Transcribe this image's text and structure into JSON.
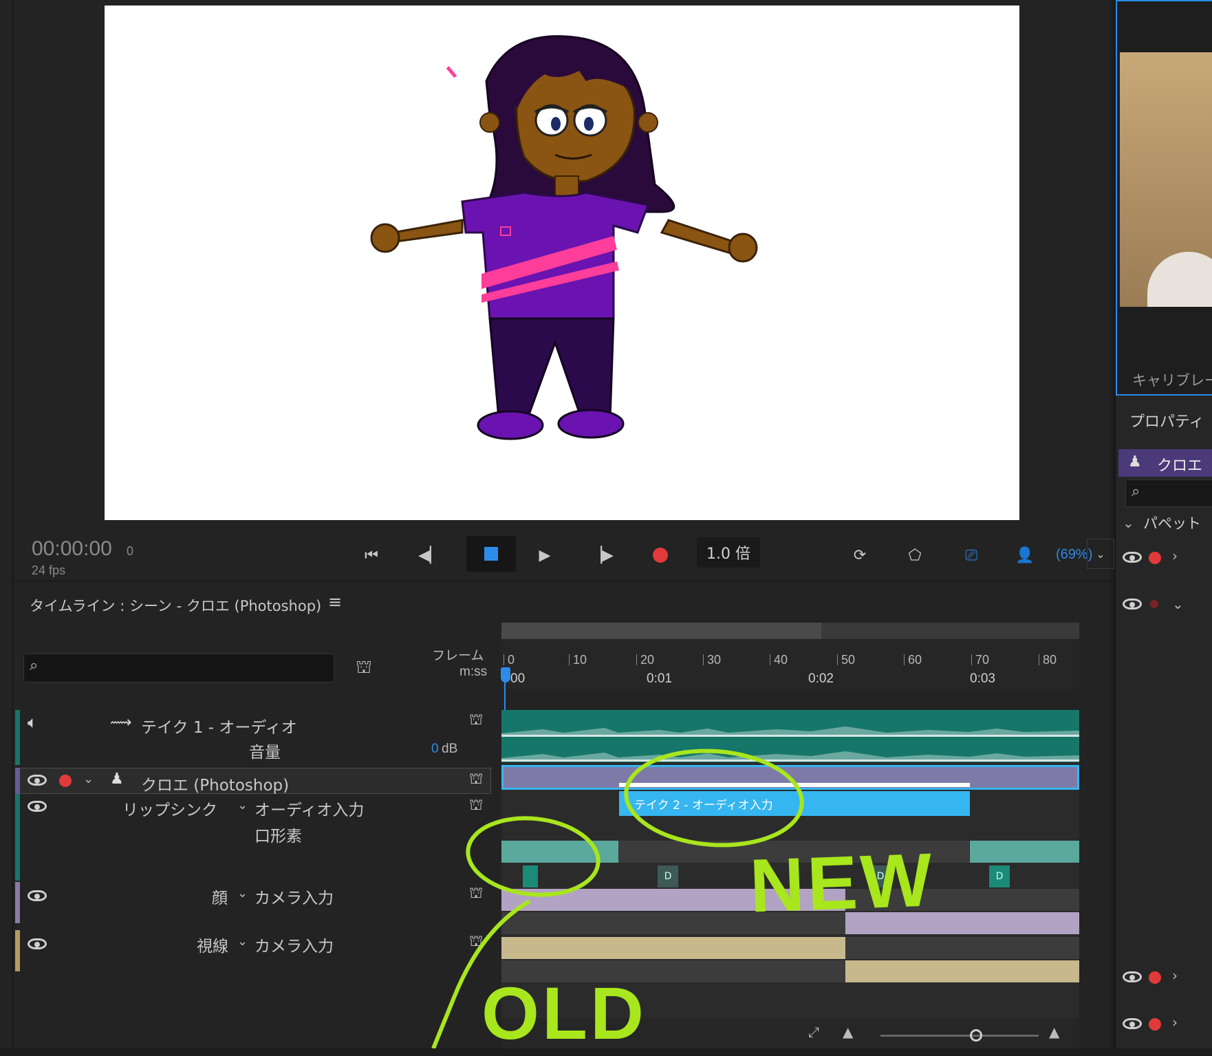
{
  "transport": {
    "timecode": "00:00:00",
    "frame": "0",
    "fps": "24 fps",
    "speed": "1.0 倍",
    "zoom": "(69%)"
  },
  "timeline": {
    "title": "タイムライン : シーン - クロエ (Photoshop)",
    "search_placeholder": "",
    "ruler_frame_label": "フレーム",
    "ruler_time_label": "m:ss",
    "frame_ticks": [
      "0",
      "10",
      "20",
      "30",
      "40",
      "50",
      "60",
      "70",
      "80"
    ],
    "time_ticks": [
      "00",
      "0:01",
      "0:02",
      "0:03"
    ],
    "tracks": {
      "audio_take": "テイク 1 - オーディオ",
      "volume_label": "音量",
      "volume_value": "0",
      "volume_unit": "dB",
      "puppet": "クロエ (Photoshop)",
      "lipsync": "リップシンク",
      "lipsync_input": "オーディオ入力",
      "lipsync_sub": "口形素",
      "take2_clip": "テイク 2 - オーディオ入力",
      "face": "顔",
      "face_input": "カメラ入力",
      "gaze": "視線",
      "gaze_input": "カメラ入力"
    },
    "visemes": [
      "D",
      "D",
      "D"
    ]
  },
  "annotations": {
    "new": "NEW",
    "old": "OLD"
  },
  "right_panel": {
    "calibrate": "キャリブレー",
    "properties": "プロパティ",
    "puppet": "クロエ",
    "group": "パペット"
  },
  "colors": {
    "audio_track": "#17766a",
    "puppet_bar": "#7e7aa8",
    "take2_clip": "#35b6f0",
    "face_track": "#b2a3c4",
    "gaze_track": "#c8b98c",
    "annotation": "#a8e61d",
    "record": "#e23a3a",
    "accent": "#2d8ceb"
  }
}
